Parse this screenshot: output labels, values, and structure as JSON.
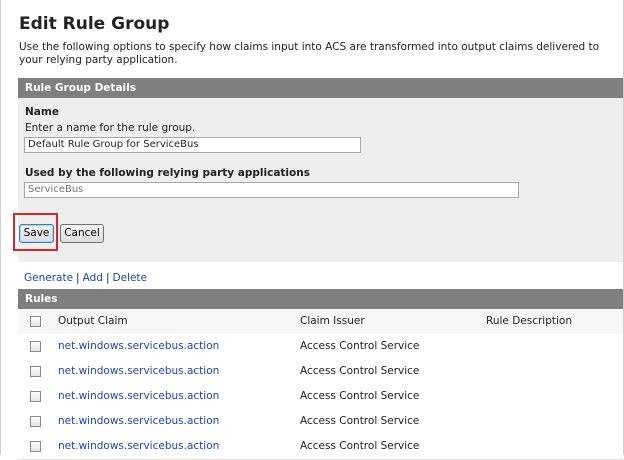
{
  "page": {
    "title": "Edit Rule Group",
    "intro": "Use the following options to specify how claims input into ACS are transformed into output claims delivered to your relying party application."
  },
  "details": {
    "header": "Rule Group Details",
    "name_label": "Name",
    "name_help": "Enter a name for the rule group.",
    "name_value": "Default Rule Group for ServiceBus",
    "used_by_label": "Used by the following relying party applications",
    "used_by_value": "ServiceBus"
  },
  "buttons": {
    "save": "Save",
    "cancel": "Cancel"
  },
  "actions": {
    "generate": "Generate",
    "add": "Add",
    "delete": "Delete",
    "separator": "|"
  },
  "rules": {
    "header": "Rules",
    "columns": [
      "Output Claim",
      "Claim Issuer",
      "Rule Description"
    ],
    "rows": [
      {
        "output_claim": "net.windows.servicebus.action",
        "claim_issuer": "Access Control Service",
        "description": ""
      },
      {
        "output_claim": "net.windows.servicebus.action",
        "claim_issuer": "Access Control Service",
        "description": ""
      },
      {
        "output_claim": "net.windows.servicebus.action",
        "claim_issuer": "Access Control Service",
        "description": ""
      },
      {
        "output_claim": "net.windows.servicebus.action",
        "claim_issuer": "Access Control Service",
        "description": ""
      },
      {
        "output_claim": "net.windows.servicebus.action",
        "claim_issuer": "Access Control Service",
        "description": ""
      }
    ]
  },
  "colors": {
    "section_header_bg": "#7f7f7f",
    "panel_bg": "#eeeeee",
    "link": "#1a44c8",
    "highlight": "#d9242c"
  }
}
